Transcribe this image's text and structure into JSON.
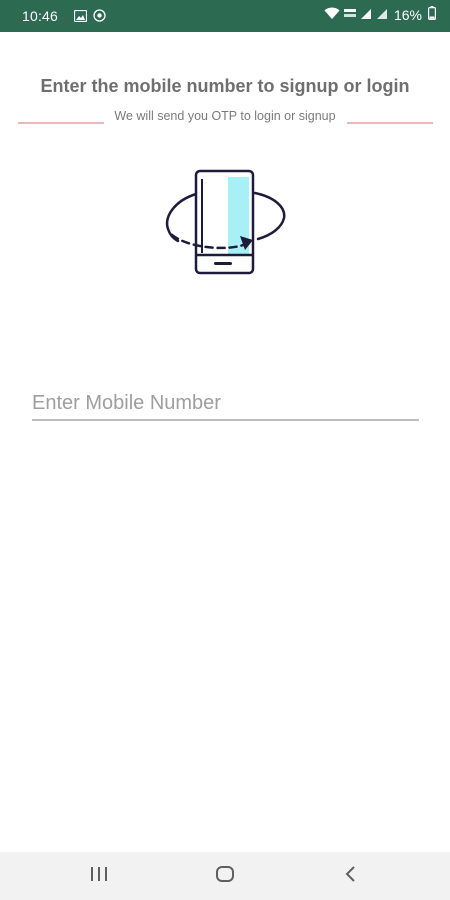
{
  "status_bar": {
    "time": "10:46",
    "battery": "16%",
    "color": "#2c6a52"
  },
  "main": {
    "title": "Enter the mobile number to signup or login",
    "subtitle": "We will send you OTP to login or signup",
    "accent_line_color": "#e9b9b5",
    "illustration_icon": "phone-rotate-icon"
  },
  "form": {
    "mobile_placeholder": "Enter Mobile Number",
    "mobile_value": ""
  },
  "nav_bar": {
    "recents_icon": "recents-icon",
    "home_icon": "home-icon",
    "back_icon": "back-icon"
  }
}
